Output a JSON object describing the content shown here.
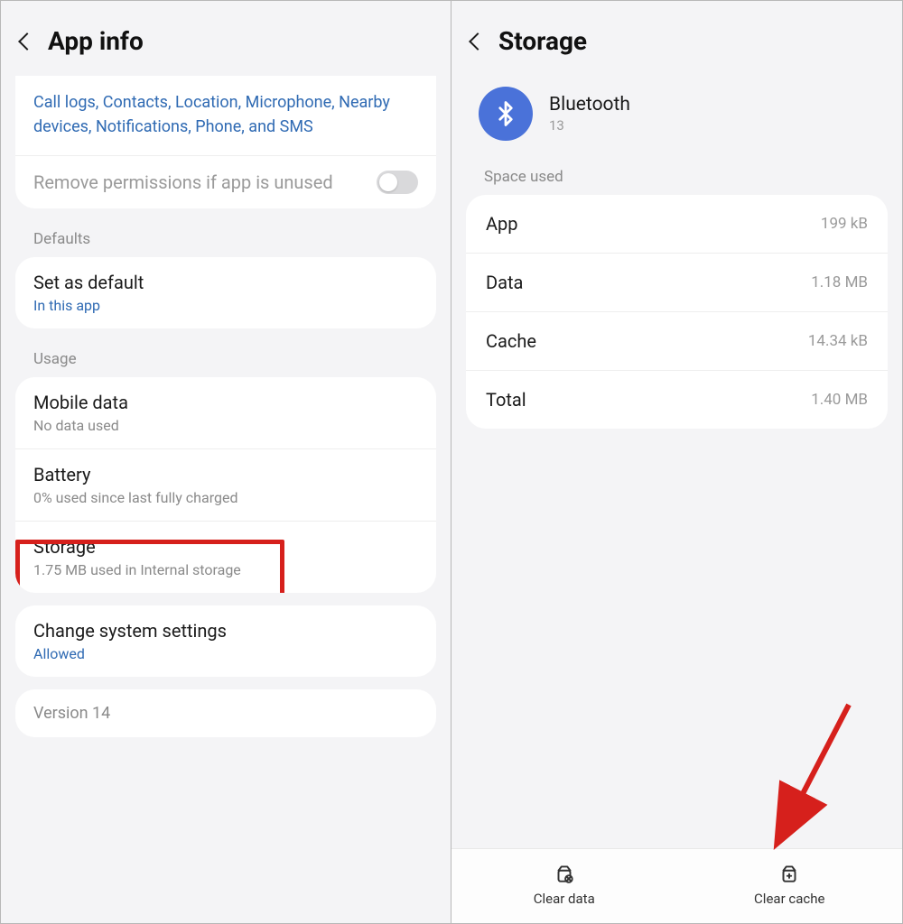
{
  "left": {
    "title": "App info",
    "permissions_text": "Call logs, Contacts, Location, Microphone, Nearby devices, Notifications, Phone, and SMS",
    "remove_permissions": "Remove permissions if app is unused",
    "sections": {
      "defaults": "Defaults",
      "usage": "Usage"
    },
    "set_default": {
      "title": "Set as default",
      "sub": "In this app"
    },
    "mobile_data": {
      "title": "Mobile data",
      "sub": "No data used"
    },
    "battery": {
      "title": "Battery",
      "sub": "0% used since last fully charged"
    },
    "storage": {
      "title": "Storage",
      "sub": "1.75 MB used in Internal storage"
    },
    "change_sys": {
      "title": "Change system settings",
      "sub": "Allowed"
    },
    "version": "Version 14"
  },
  "right": {
    "title": "Storage",
    "app": {
      "name": "Bluetooth",
      "version": "13"
    },
    "space_used_label": "Space used",
    "rows": {
      "app": {
        "key": "App",
        "val": "199 kB"
      },
      "data": {
        "key": "Data",
        "val": "1.18 MB"
      },
      "cache": {
        "key": "Cache",
        "val": "14.34 kB"
      },
      "total": {
        "key": "Total",
        "val": "1.40 MB"
      }
    },
    "buttons": {
      "clear_data": "Clear data",
      "clear_cache": "Clear cache"
    }
  }
}
